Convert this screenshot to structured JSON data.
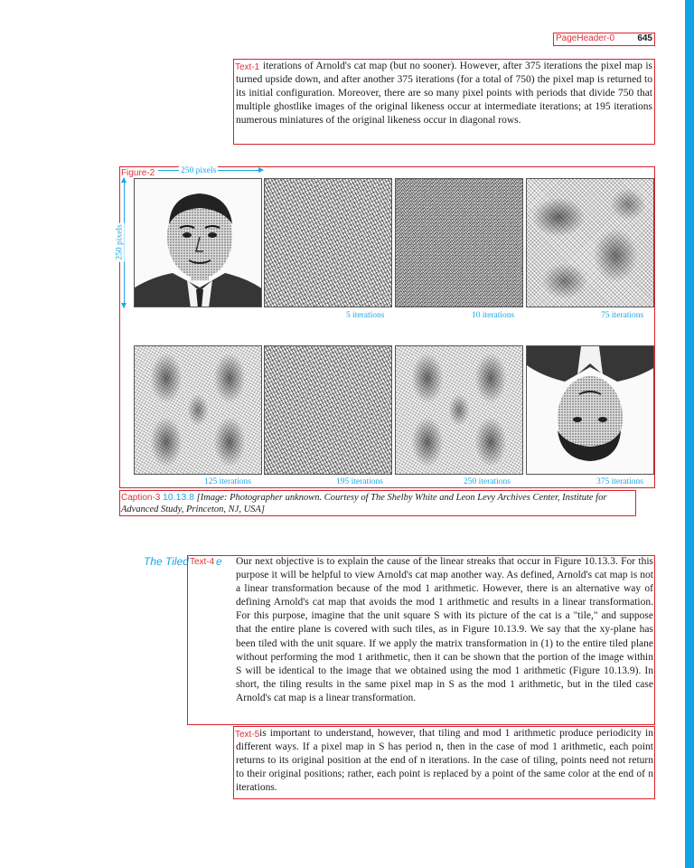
{
  "header": {
    "page_number": "645",
    "label": "PageHeader-0"
  },
  "text1": {
    "label": "Text-1",
    "content": "iterations of Arnold's cat map (but no sooner). However, after 375 iterations the pixel map is turned upside down, and after another 375 iterations (for a total of 750) the pixel map is returned to its initial configuration. Moreover, there are so many pixel points with periods that divide 750 that multiple ghostlike images of the original likeness occur at intermediate iterations; at 195 iterations numerous miniatures of the original likeness occur in diagonal rows."
  },
  "figure": {
    "label": "Figure-2",
    "width_label": "250 pixels",
    "height_label": "250 pixels",
    "panels": [
      {
        "iterations": ""
      },
      {
        "iterations": "5 iterations"
      },
      {
        "iterations": "10 iterations"
      },
      {
        "iterations": "75 iterations"
      },
      {
        "iterations": "125 iterations"
      },
      {
        "iterations": "195 iterations"
      },
      {
        "iterations": "250 iterations"
      },
      {
        "iterations": "375 iterations"
      }
    ]
  },
  "caption": {
    "label": "Caption-3",
    "number": "10.13.8",
    "text": "[Image: Photographer unknown. Courtesy of The Shelby White and Leon Levy Archives Center, Institute for Advanced Study, Princeton, NJ, USA]"
  },
  "margin_heading": {
    "text": "The Tiled",
    "suffix": "e"
  },
  "text4": {
    "label": "Text-4",
    "content": "Our next objective is to explain the cause of the linear streaks that occur in Figure 10.13.3. For this purpose it will be helpful to view Arnold's cat map another way. As defined, Arnold's cat map is not a linear transformation because of the mod 1 arithmetic. However, there is an alternative way of defining Arnold's cat map that avoids the mod 1 arithmetic and results in a linear transformation. For this purpose, imagine that the unit square S with its picture of the cat is a \"tile,\" and suppose that the entire plane is covered with such tiles, as in Figure 10.13.9. We say that the xy-plane has been tiled with the unit square. If we apply the matrix transformation in (1) to the entire tiled plane without performing the mod 1 arithmetic, then it can be shown that the portion of the image within S will be identical to the image that we obtained using the mod 1 arithmetic (Figure 10.13.9). In short, the tiling results in the same pixel map in S as the mod 1 arithmetic, but in the tiled case Arnold's cat map is a linear transformation."
  },
  "text5": {
    "label": "Text-5",
    "content": "is important to understand, however, that tiling and mod 1 arithmetic produce periodicity in different ways. If a pixel map in S has period n, then in the case of mod 1 arithmetic, each point returns to its original position at the end of n iterations. In the case of tiling, points need not return to their original positions; rather, each point is replaced by a point of the same color at the end of n iterations."
  },
  "colors": {
    "accent": "#19a8e6",
    "annotation": "#d9232d",
    "side_bar": "#16a3e6"
  }
}
